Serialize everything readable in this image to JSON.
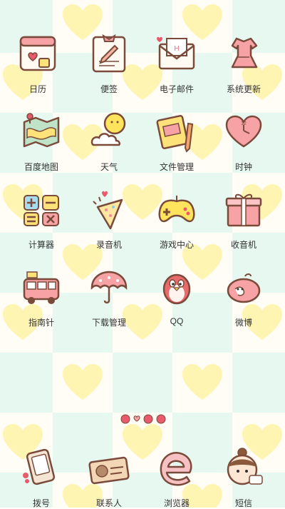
{
  "apps": [
    {
      "label": "日历",
      "icon": "calendar-icon"
    },
    {
      "label": "便签",
      "icon": "notepad-icon"
    },
    {
      "label": "电子邮件",
      "icon": "envelope-icon"
    },
    {
      "label": "系统更新",
      "icon": "dress-icon"
    },
    {
      "label": "百度地图",
      "icon": "map-icon"
    },
    {
      "label": "天气",
      "icon": "sun-cloud-icon"
    },
    {
      "label": "文件管理",
      "icon": "notebook-pencil-icon"
    },
    {
      "label": "时钟",
      "icon": "heart-clock-icon"
    },
    {
      "label": "计算器",
      "icon": "calculator-symbols-icon"
    },
    {
      "label": "录音机",
      "icon": "party-cone-icon"
    },
    {
      "label": "游戏中心",
      "icon": "gamepad-icon"
    },
    {
      "label": "收音机",
      "icon": "gift-box-icon"
    },
    {
      "label": "指南针",
      "icon": "bus-icon"
    },
    {
      "label": "下载管理",
      "icon": "umbrella-icon"
    },
    {
      "label": "QQ",
      "icon": "penguin-icon"
    },
    {
      "label": "微博",
      "icon": "pink-bird-icon"
    }
  ],
  "dock": [
    {
      "label": "拨号",
      "icon": "phone-icon"
    },
    {
      "label": "联系人",
      "icon": "contact-card-icon"
    },
    {
      "label": "浏览器",
      "icon": "browser-e-icon"
    },
    {
      "label": "短信",
      "icon": "girl-face-icon"
    }
  ],
  "colors": {
    "outline": "#7a4a3a",
    "pink": "#f7a3a6",
    "yellow": "#fff3a6",
    "mint": "#e7f8f1"
  }
}
